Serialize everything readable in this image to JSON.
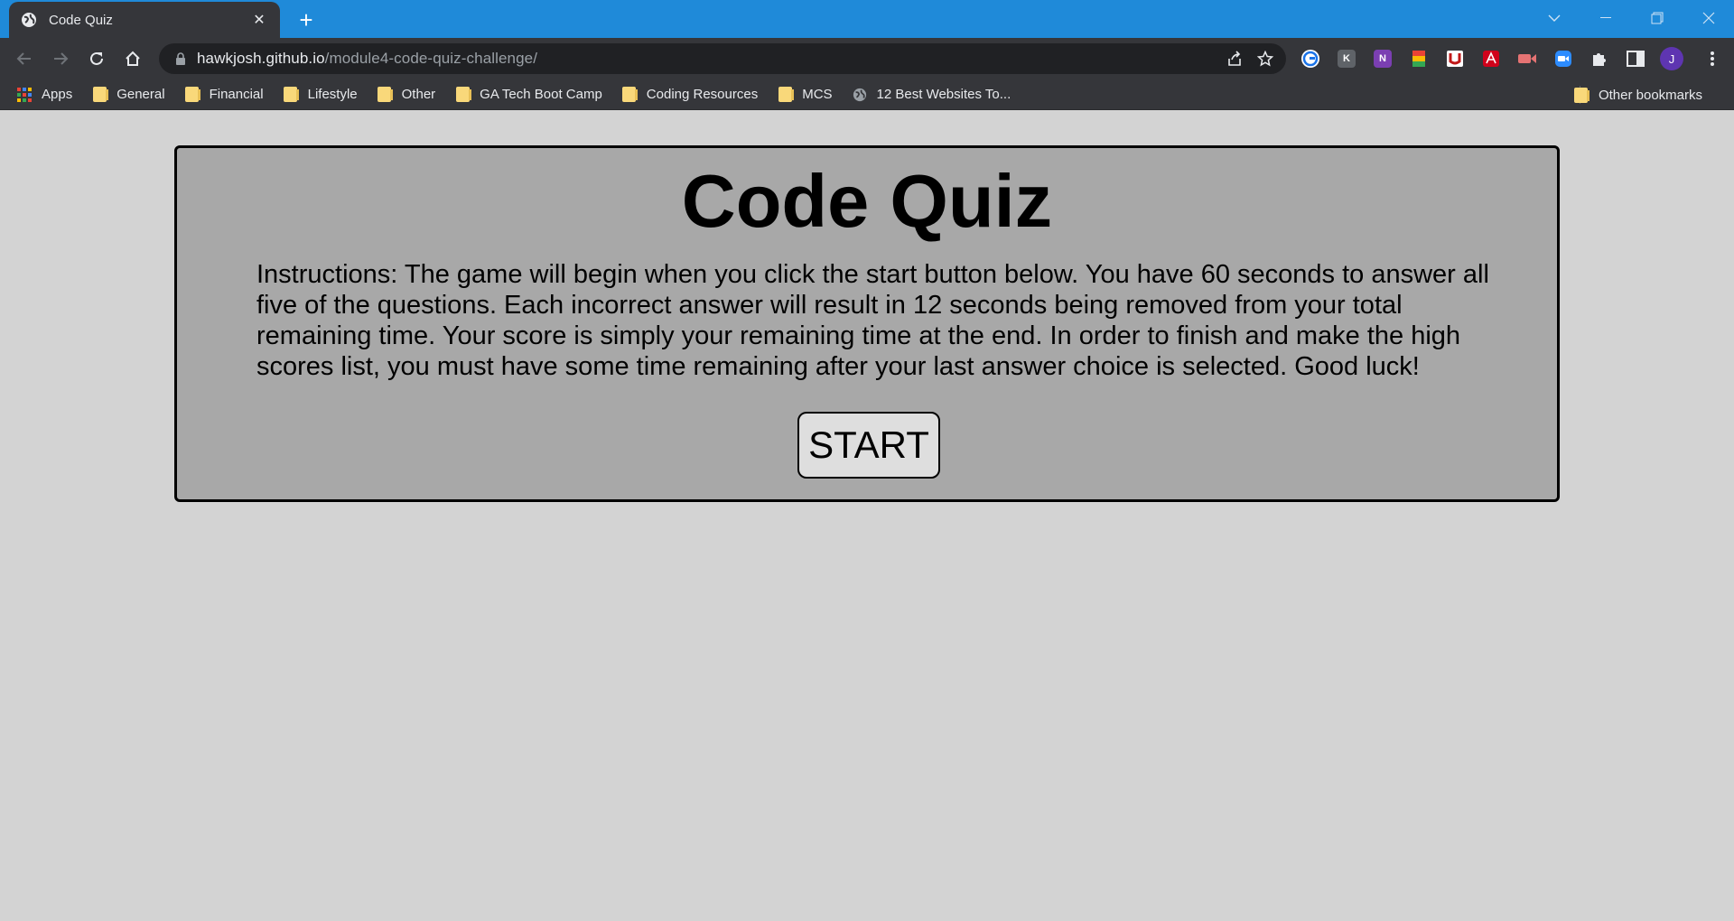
{
  "browser": {
    "tab": {
      "title": "Code Quiz",
      "favicon": "globe-icon",
      "close": "✕"
    },
    "new_tab": "+",
    "url": {
      "host": "hawkjosh.github.io",
      "path": "/module4-code-quiz-challenge/"
    },
    "avatar_letter": "J",
    "extensions": [
      {
        "name": "grammar-extension-icon",
        "color": "#ffffff",
        "label": "G"
      },
      {
        "name": "gray-extension-icon",
        "color": "#9aa0a6",
        "label": "K"
      },
      {
        "name": "onenote-clipper-icon",
        "color": "#7b3fb2",
        "label": "N"
      },
      {
        "name": "google-sheets-icon",
        "color": "#0f9d58",
        "label": ""
      },
      {
        "name": "mcafee-icon",
        "color": "#ffffff",
        "label": ""
      },
      {
        "name": "adobe-acrobat-icon",
        "color": "#d0021b",
        "label": ""
      },
      {
        "name": "screencast-icon",
        "color": "#e57373",
        "label": ""
      },
      {
        "name": "zoom-icon",
        "color": "#2d8cff",
        "label": ""
      }
    ]
  },
  "bookmarks": {
    "items": [
      {
        "label": "Apps",
        "icon": "apps-grid-icon"
      },
      {
        "label": "General",
        "icon": "folder-icon"
      },
      {
        "label": "Financial",
        "icon": "folder-icon"
      },
      {
        "label": "Lifestyle",
        "icon": "folder-icon"
      },
      {
        "label": "Other",
        "icon": "folder-icon"
      },
      {
        "label": "GA Tech Boot Camp",
        "icon": "folder-icon"
      },
      {
        "label": "Coding Resources",
        "icon": "folder-icon"
      },
      {
        "label": "MCS",
        "icon": "folder-icon"
      },
      {
        "label": "12 Best Websites To...",
        "icon": "globe-icon"
      }
    ],
    "other": "Other bookmarks"
  },
  "page": {
    "title": "Code Quiz",
    "instructions": "Instructions: The game will begin when you click the start button below. You have 60 seconds to answer all five of the questions. Each incorrect answer will result in 12 seconds being removed from your total remaining time. Your score is simply your remaining time at the end. In order to finish and make the high scores list, you must have some time remaining after your last answer choice is selected. Good luck!",
    "start_label": "START"
  },
  "colors": {
    "tabstrip": "#1f8ad9",
    "toolbar": "#35363a",
    "page_bg": "#d3d3d3",
    "card_bg": "#a8a8a8"
  }
}
